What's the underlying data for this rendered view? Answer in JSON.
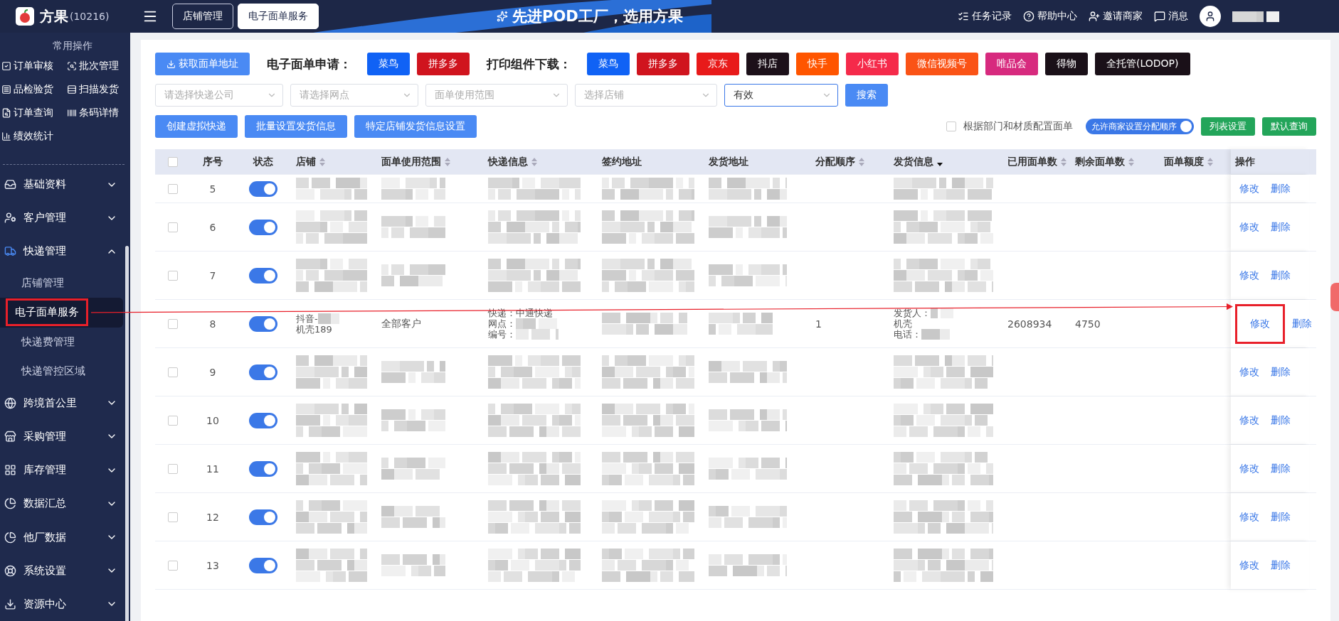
{
  "header": {
    "brand": "方果",
    "brand_code": "(10216)",
    "tabs": [
      {
        "label": "店铺管理",
        "selected": false
      },
      {
        "label": "电子面单服务",
        "selected": true
      }
    ],
    "slogan": "先进POD工厂，选用方果",
    "links": [
      "任务记录",
      "帮助中心",
      "邀请商家",
      "消息"
    ]
  },
  "sidebar": {
    "quick_title": "常用操作",
    "quick": [
      "订单审核",
      "批次管理",
      "品检验货",
      "扫描发货",
      "订单查询",
      "条码详情",
      "绩效统计"
    ],
    "menu": [
      {
        "label": "基础资料",
        "expanded": false
      },
      {
        "label": "客户管理",
        "expanded": false
      },
      {
        "label": "快递管理",
        "expanded": true,
        "children": [
          {
            "label": "店铺管理",
            "selected": false,
            "annotated": false
          },
          {
            "label": "电子面单服务",
            "selected": true,
            "annotated": true
          },
          {
            "label": "快递费管理",
            "selected": false,
            "annotated": false
          },
          {
            "label": "快递管控区域",
            "selected": false,
            "annotated": false
          }
        ]
      },
      {
        "label": "跨境首公里",
        "expanded": false
      },
      {
        "label": "采购管理",
        "expanded": false
      },
      {
        "label": "库存管理",
        "expanded": false
      },
      {
        "label": "数据汇总",
        "expanded": false
      },
      {
        "label": "他厂数据",
        "expanded": false
      },
      {
        "label": "系统设置",
        "expanded": false
      },
      {
        "label": "资源中心",
        "expanded": false
      }
    ]
  },
  "toolbar": {
    "fetch_button": "获取面单地址",
    "apply_label": "电子面单申请：",
    "apply_buttons": [
      {
        "label": "菜鸟",
        "color": "#1062f5"
      },
      {
        "label": "拼多多",
        "color": "#d0141e"
      }
    ],
    "download_label": "打印组件下载：",
    "download_buttons": [
      {
        "label": "菜鸟",
        "color": "#1062f5"
      },
      {
        "label": "拼多多",
        "color": "#d0141e"
      },
      {
        "label": "京东",
        "color": "#e81a1a"
      },
      {
        "label": "抖店",
        "color": "#1c1019"
      },
      {
        "label": "快手",
        "color": "#ff5500"
      },
      {
        "label": "小红书",
        "color": "#f52a4a"
      },
      {
        "label": "微信视频号",
        "color": "#fa5316"
      },
      {
        "label": "唯品会",
        "color": "#d72a7e"
      },
      {
        "label": "得物",
        "color": "#1a1018"
      },
      {
        "label": "全托管(LODOP)",
        "color": "#1a1018"
      }
    ]
  },
  "filters": [
    {
      "placeholder": "请选择快递公司"
    },
    {
      "placeholder": "请选择网点"
    },
    {
      "placeholder": "面单使用范围"
    },
    {
      "placeholder": "选择店铺"
    },
    {
      "value": "有效"
    }
  ],
  "search_button": "搜索",
  "actions": [
    "创建虚拟快递",
    "批量设置发货信息",
    "特定店铺发货信息设置"
  ],
  "dept_option": {
    "label": "根据部门和材质配置面单",
    "checked": false
  },
  "order_switch": {
    "label": "允许商家设置分配顺序",
    "on": true
  },
  "right_buttons": [
    "列表设置",
    "默认查询"
  ],
  "table": {
    "all_checked": false,
    "columns": [
      {
        "label": "序号"
      },
      {
        "label": "状态"
      },
      {
        "label": "店铺",
        "sorted_desc": false
      },
      {
        "label": "面单使用范围",
        "sorted_desc": false
      },
      {
        "label": "快递信息",
        "sorted_desc": false
      },
      {
        "label": "签约地址"
      },
      {
        "label": "发货地址"
      },
      {
        "label": "分配顺序",
        "sorted_desc": false
      },
      {
        "label": "发货信息",
        "sorted_desc": true
      },
      {
        "label": "已用面单数",
        "sorted_desc": false
      },
      {
        "label": "剩余面单数",
        "sorted_desc": false
      },
      {
        "label": "面单额度",
        "sorted_desc": false
      },
      {
        "label": "操作"
      }
    ],
    "rows": [
      {
        "no": "5",
        "checked": false,
        "on": true,
        "redacted": true,
        "edit": "修改",
        "delete": "删除",
        "annotated": false
      },
      {
        "no": "6",
        "checked": false,
        "on": true,
        "redacted": true,
        "edit": "修改",
        "delete": "删除",
        "annotated": false
      },
      {
        "no": "7",
        "checked": false,
        "on": true,
        "redacted": true,
        "edit": "修改",
        "delete": "删除",
        "annotated": false
      },
      {
        "no": "8",
        "checked": false,
        "on": true,
        "redacted": false,
        "shop": [
          "抖音-",
          "机壳189"
        ],
        "scope": "全部客户",
        "express": [
          "快递：中通快递",
          "网点：",
          "编号："
        ],
        "order": "1",
        "sender": [
          "发货人：",
          "机壳",
          "电话："
        ],
        "used": "2608934",
        "remaining": "4750",
        "edit": "修改",
        "delete": "删除",
        "annotated": true
      },
      {
        "no": "9",
        "checked": false,
        "on": true,
        "redacted": true,
        "edit": "修改",
        "delete": "删除",
        "annotated": false
      },
      {
        "no": "10",
        "checked": false,
        "on": true,
        "redacted": true,
        "edit": "修改",
        "delete": "删除",
        "annotated": false
      },
      {
        "no": "11",
        "checked": false,
        "on": true,
        "redacted": true,
        "edit": "修改",
        "delete": "删除",
        "annotated": false
      },
      {
        "no": "12",
        "checked": false,
        "on": true,
        "redacted": true,
        "edit": "修改",
        "delete": "删除",
        "annotated": false
      },
      {
        "no": "13",
        "checked": false,
        "on": true,
        "redacted": true,
        "edit": "修改",
        "delete": "删除",
        "annotated": false
      }
    ]
  },
  "annotation": {
    "arrow": true
  }
}
